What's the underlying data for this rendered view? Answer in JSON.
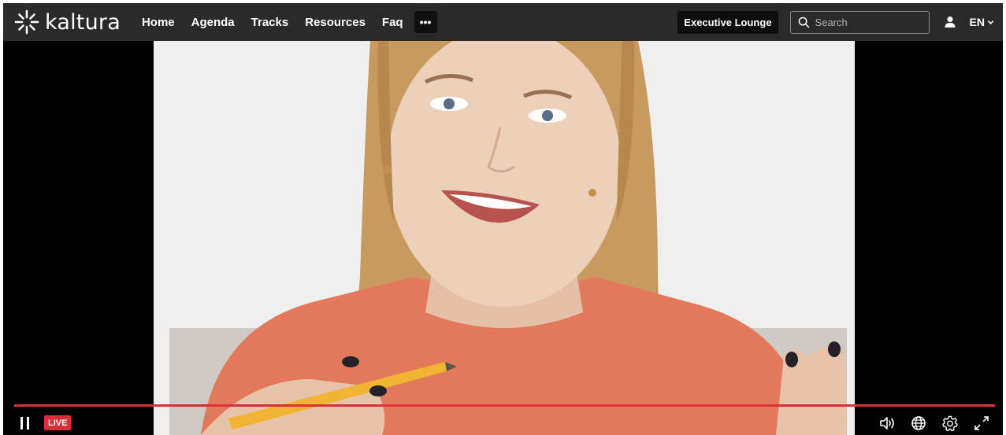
{
  "brand": {
    "logo_text": "kaltura",
    "logo_icon": "kaltura-asterisk-icon"
  },
  "nav": {
    "items": [
      {
        "label": "Home"
      },
      {
        "label": "Agenda"
      },
      {
        "label": "Tracks"
      },
      {
        "label": "Resources"
      },
      {
        "label": "Faq"
      }
    ],
    "more_label": "•••"
  },
  "header": {
    "lounge_label": "Executive Lounge",
    "search_placeholder": "Search",
    "search_icon": "search-icon",
    "user_icon": "user-icon",
    "language": "EN",
    "language_icon": "chevron-down-icon"
  },
  "player": {
    "live_label": "LIVE",
    "progress": 1.0,
    "accent_color": "#d9303a",
    "controls": [
      "pause-icon",
      "volume-icon",
      "globe-icon",
      "gear-icon",
      "fullscreen-icon"
    ]
  },
  "colors": {
    "topbar": "#2a2a2a",
    "background": "#000000"
  }
}
